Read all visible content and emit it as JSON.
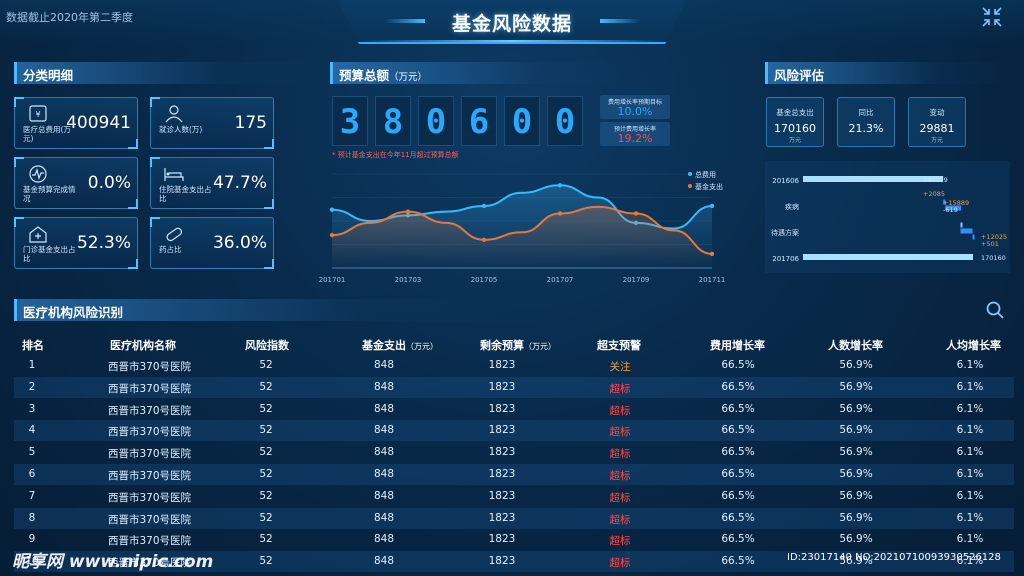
{
  "header": {
    "date_note": "数据截止2020年第二季度",
    "title": "基金风险数据"
  },
  "category": {
    "title": "分类明细",
    "cards": [
      {
        "label": "医疗总费用(万元)",
        "value": "400941",
        "icon": "wallet-icon"
      },
      {
        "label": "就诊人数(万)",
        "value": "175",
        "icon": "people-icon"
      },
      {
        "label": "基金预算完成情况",
        "value": "0.0%",
        "icon": "pulse-icon"
      },
      {
        "label": "住院基金支出占比",
        "value": "47.7%",
        "icon": "bed-icon"
      },
      {
        "label": "门诊基金支出占比",
        "value": "52.3%",
        "icon": "clinic-icon"
      },
      {
        "label": "药占比",
        "value": "36.0%",
        "icon": "pill-icon"
      }
    ]
  },
  "budget": {
    "title": "预算总额",
    "unit": "（万元）",
    "digits": [
      "3",
      "8",
      "0",
      "6",
      "0",
      "0"
    ],
    "note": "* 预计基金支出在今年11月超过预算总额",
    "mini1_label": "费用增长率预期目标",
    "mini1_value": "10.0%",
    "mini2_label": "预计费用增长率",
    "mini2_value": "19.2%",
    "colors": {
      "accent": "#29a8ff",
      "alert": "#ff4b4b",
      "follow": "#f0a24b"
    }
  },
  "chart_data": {
    "type": "line",
    "x": [
      "201701",
      "201702",
      "201703",
      "201704",
      "201705",
      "201706",
      "201707",
      "201708",
      "201709",
      "201710",
      "201711"
    ],
    "categories_shown": [
      "201701",
      "201703",
      "201705",
      "201707",
      "201709",
      "201711"
    ],
    "series": [
      {
        "name": "总费用",
        "color": "#3ab8ff",
        "values": [
          0.62,
          0.5,
          0.56,
          0.6,
          0.66,
          0.8,
          0.88,
          0.75,
          0.48,
          0.42,
          0.66
        ]
      },
      {
        "name": "基金支出",
        "color": "#e8783a",
        "values": [
          0.35,
          0.48,
          0.6,
          0.48,
          0.3,
          0.38,
          0.58,
          0.65,
          0.58,
          0.4,
          0.15
        ]
      }
    ],
    "ylim": [
      0,
      1
    ],
    "legend": "top-right"
  },
  "risk": {
    "title": "风险评估",
    "cards": [
      {
        "title": "基金总支出",
        "value": "170160",
        "unit": "万元"
      },
      {
        "title": "同比",
        "value": "21.3%",
        "unit": ""
      },
      {
        "title": "变动",
        "value": "29881",
        "unit": "万元"
      }
    ],
    "bars": {
      "categories": [
        "201606",
        "疾病",
        "待遇方案",
        "201706"
      ],
      "labels": [
        "140279",
        "+2085",
        "+15889",
        "-619",
        "+12025",
        "+501",
        "170160"
      ],
      "values": {
        "base_start": 140279,
        "steps": [
          2085,
          15889,
          -619,
          12025,
          501
        ],
        "base_end": 170160
      }
    }
  },
  "table": {
    "title": "医疗机构风险识别",
    "headers": [
      "排名",
      "医疗机构名称",
      "风险指数",
      "基金支出",
      "剩余预算",
      "超支预警",
      "费用增长率",
      "人数增长率",
      "人均增长率"
    ],
    "header_units": [
      "",
      "",
      "",
      "（万元）",
      "（万元）",
      "",
      "",
      "",
      ""
    ],
    "rows": [
      [
        "1",
        "西晋市370号医院",
        "52",
        "848",
        "1823",
        "关注",
        "66.5%",
        "56.9%",
        "6.1%"
      ],
      [
        "2",
        "西晋市370号医院",
        "52",
        "848",
        "1823",
        "超标",
        "66.5%",
        "56.9%",
        "6.1%"
      ],
      [
        "3",
        "西晋市370号医院",
        "52",
        "848",
        "1823",
        "超标",
        "66.5%",
        "56.9%",
        "6.1%"
      ],
      [
        "4",
        "西晋市370号医院",
        "52",
        "848",
        "1823",
        "超标",
        "66.5%",
        "56.9%",
        "6.1%"
      ],
      [
        "5",
        "西晋市370号医院",
        "52",
        "848",
        "1823",
        "超标",
        "66.5%",
        "56.9%",
        "6.1%"
      ],
      [
        "6",
        "西晋市370号医院",
        "52",
        "848",
        "1823",
        "超标",
        "66.5%",
        "56.9%",
        "6.1%"
      ],
      [
        "7",
        "西晋市370号医院",
        "52",
        "848",
        "1823",
        "超标",
        "66.5%",
        "56.9%",
        "6.1%"
      ],
      [
        "8",
        "西晋市370号医院",
        "52",
        "848",
        "1823",
        "超标",
        "66.5%",
        "56.9%",
        "6.1%"
      ],
      [
        "9",
        "西晋市370号医院",
        "52",
        "848",
        "1823",
        "超标",
        "66.5%",
        "56.9%",
        "6.1%"
      ],
      [
        "10",
        "西晋市370号医院",
        "52",
        "848",
        "1823",
        "超标",
        "66.5%",
        "56.9%",
        "6.1%"
      ]
    ]
  },
  "watermark": {
    "left": "昵享网 www.nipic.com",
    "right": "ID:23017140 NO:20210710093930526128"
  }
}
